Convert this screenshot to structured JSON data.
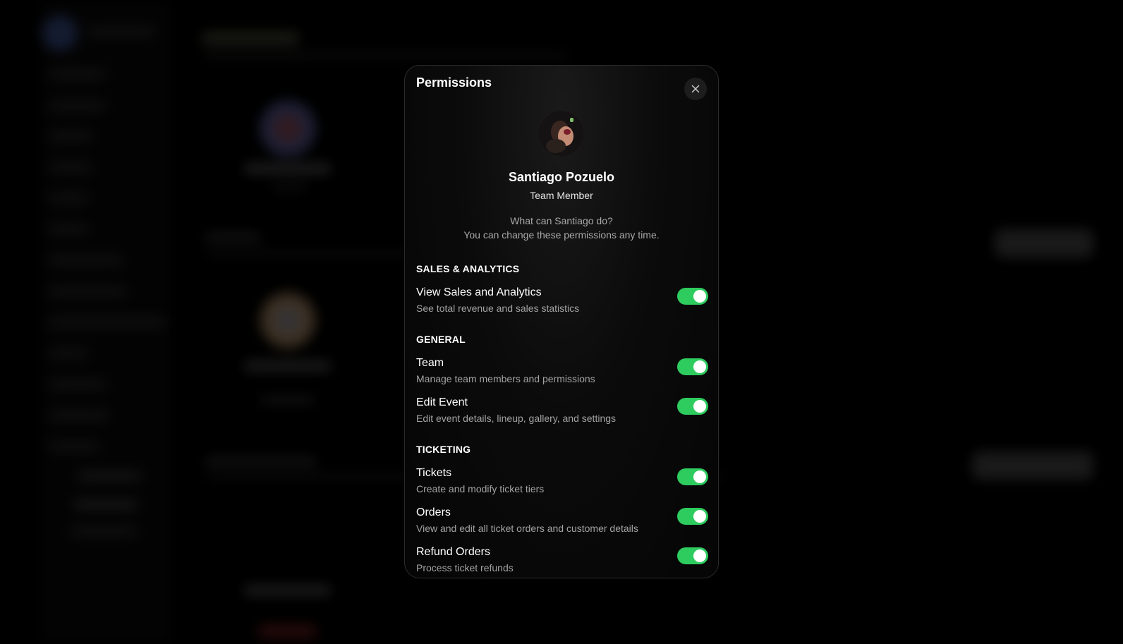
{
  "modal": {
    "title": "Permissions",
    "close_icon": "close-icon"
  },
  "profile": {
    "name": "Santiago Pozuelo",
    "role": "Team Member",
    "avatar_icon": "user-avatar-photo"
  },
  "intro": {
    "question": "What can Santiago do?",
    "note": "You can change these permissions any time."
  },
  "colors": {
    "toggle_on": "#2ecc5e",
    "background": "#000000",
    "muted_text": "#a3a3a3"
  },
  "sections": [
    {
      "heading": "SALES & ANALYTICS",
      "items": [
        {
          "title": "View Sales and Analytics",
          "description": "See total revenue and sales statistics",
          "enabled": true
        }
      ]
    },
    {
      "heading": "GENERAL",
      "items": [
        {
          "title": "Team",
          "description": "Manage team members and permissions",
          "enabled": true
        },
        {
          "title": "Edit Event",
          "description": "Edit event details, lineup, gallery, and settings",
          "enabled": true
        }
      ]
    },
    {
      "heading": "TICKETING",
      "items": [
        {
          "title": "Tickets",
          "description": "Create and modify ticket tiers",
          "enabled": true
        },
        {
          "title": "Orders",
          "description": "View and edit all ticket orders and customer details",
          "enabled": true
        },
        {
          "title": "Refund Orders",
          "description": "Process ticket refunds",
          "enabled": true
        }
      ]
    }
  ]
}
